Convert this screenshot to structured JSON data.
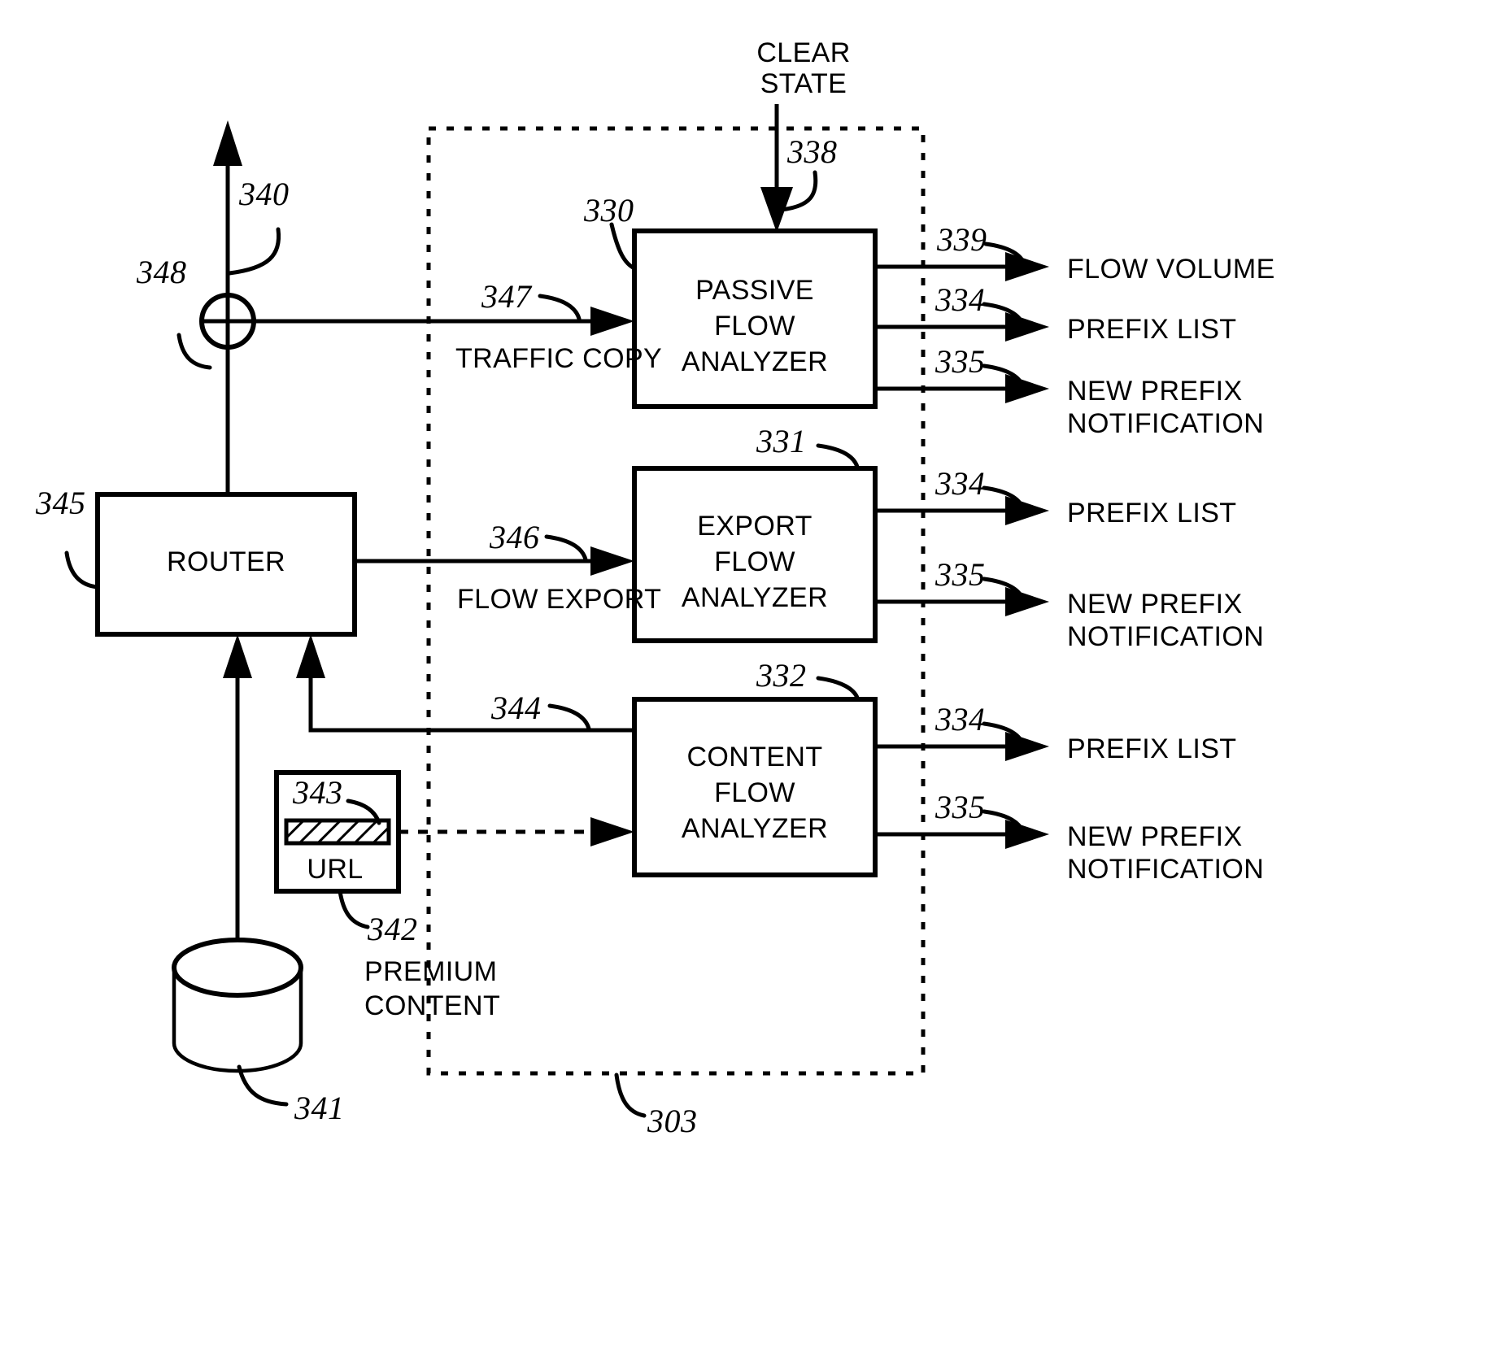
{
  "figure": {
    "title": "Network flow analysis block diagram",
    "background_color": "#ffffff",
    "line_color": "#000000"
  },
  "blocks": {
    "router": {
      "label": "ROUTER",
      "ref": "345"
    },
    "passive_flow_analyzer": {
      "line1": "PASSIVE",
      "line2": "FLOW",
      "line3": "ANALYZER",
      "ref": "330"
    },
    "export_flow_analyzer": {
      "line1": "EXPORT",
      "line2": "FLOW",
      "line3": "ANALYZER",
      "ref": "331"
    },
    "content_flow_analyzer": {
      "line1": "CONTENT",
      "line2": "FLOW",
      "line3": "ANALYZER",
      "ref": "332"
    },
    "url_box": {
      "label": "URL",
      "bar_ref": "343",
      "ref": "342"
    },
    "premium_content": {
      "line1": "PREMIUM",
      "line2": "CONTENT"
    },
    "content_store": {
      "ref": "341"
    },
    "analysis_system": {
      "ref": "303"
    }
  },
  "signals": {
    "uplink": {
      "ref": "340"
    },
    "tap": {
      "ref": "348"
    },
    "traffic_copy": {
      "label": "TRAFFIC COPY",
      "ref": "347"
    },
    "flow_export": {
      "label": "FLOW EXPORT",
      "ref": "346"
    },
    "content_feed": {
      "ref": "344"
    },
    "clear_state": {
      "line1": "CLEAR",
      "line2": "STATE",
      "ref": "338"
    }
  },
  "outputs": {
    "passive": [
      {
        "label": "FLOW VOLUME",
        "ref": "339"
      },
      {
        "label": "PREFIX LIST",
        "ref": "334"
      },
      {
        "label_line1": "NEW PREFIX",
        "label_line2": "NOTIFICATION",
        "ref": "335"
      }
    ],
    "export": [
      {
        "label": "PREFIX LIST",
        "ref": "334"
      },
      {
        "label_line1": "NEW PREFIX",
        "label_line2": "NOTIFICATION",
        "ref": "335"
      }
    ],
    "content": [
      {
        "label": "PREFIX LIST",
        "ref": "334"
      },
      {
        "label_line1": "NEW PREFIX",
        "label_line2": "NOTIFICATION",
        "ref": "335"
      }
    ]
  }
}
